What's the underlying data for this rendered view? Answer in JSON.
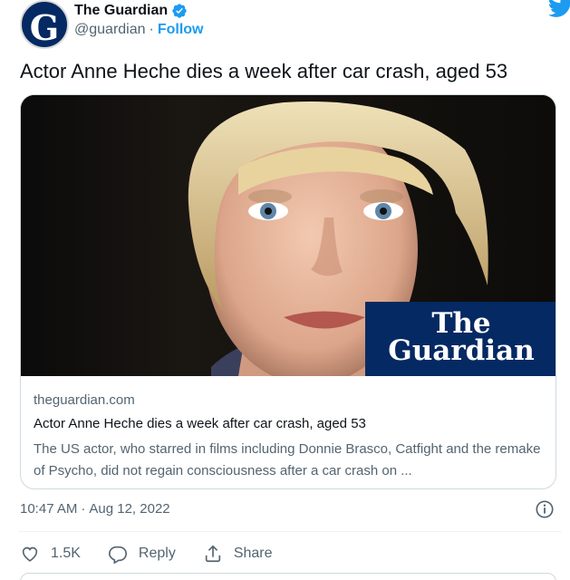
{
  "author": {
    "display_name": "The Guardian",
    "handle": "@guardian",
    "separator": "·",
    "follow_label": "Follow",
    "avatar_letter": "G",
    "verified_icon": "verified-badge-icon"
  },
  "tweet": {
    "text": "Actor Anne Heche dies a week after car crash, aged 53"
  },
  "card": {
    "domain": "theguardian.com",
    "title": "Actor Anne Heche dies a week after car crash, aged 53",
    "description": "The US actor, who starred in films including Donnie Brasco, Catfight and the remake of Psycho, did not regain consciousness after a car crash on ...",
    "logo_line1": "The",
    "logo_line2": "Guardian"
  },
  "meta": {
    "time": "10:47 AM",
    "separator": "·",
    "date": "Aug 12, 2022"
  },
  "actions": {
    "likes_count": "1.5K",
    "reply_label": "Reply",
    "share_label": "Share"
  },
  "colors": {
    "brand_blue": "#1d9bf0",
    "guardian_navy": "#052962",
    "secondary_text": "#536471"
  }
}
